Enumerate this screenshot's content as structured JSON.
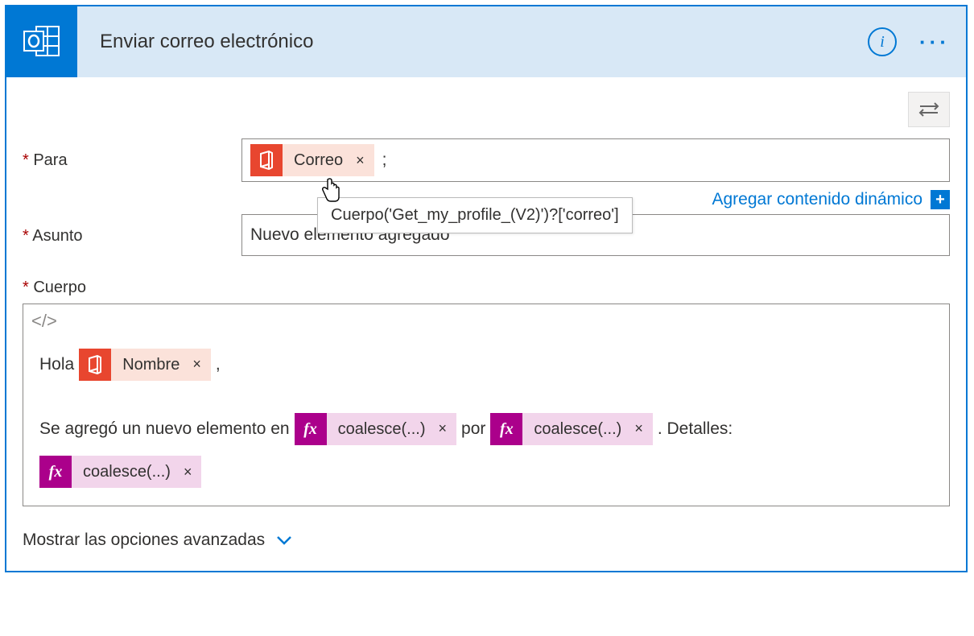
{
  "header": {
    "title": "Enviar correo electrónico",
    "info": "i",
    "more": "···"
  },
  "fields": {
    "to": {
      "label": "Para",
      "token_label": "Correo",
      "separator": ";"
    },
    "subject": {
      "label": "Asunto",
      "value": "Nuevo elemento agregado"
    },
    "body": {
      "label": "Cuerpo",
      "greeting": "Hola",
      "name_token": "Nombre",
      "comma": ",",
      "line2_pre": "Se agregó un nuevo elemento en",
      "coalesce": "coalesce(...)",
      "por": "por",
      "details": ". Detalles:"
    }
  },
  "dynamic": {
    "label": "Agregar contenido dinámico",
    "plus": "+"
  },
  "tooltip": "Cuerpo('Get_my_profile_(V2)')?['correo']",
  "advanced": "Mostrar las opciones avanzadas",
  "code_toggle": "</>",
  "fx": "fx",
  "close_x": "×"
}
